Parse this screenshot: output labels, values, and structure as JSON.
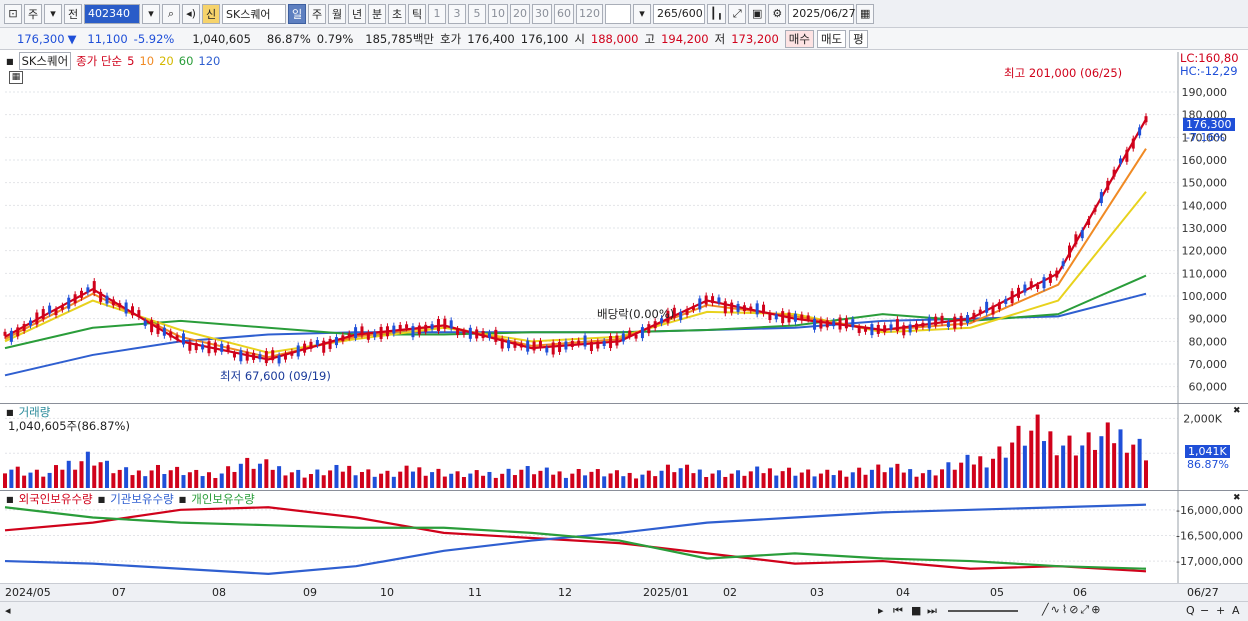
{
  "toolbar": {
    "period_main": "주",
    "prev_label": "전",
    "code": "402340",
    "badge": "신",
    "name": "SK스퀘어",
    "periods": [
      "일",
      "주",
      "월",
      "년",
      "분",
      "초",
      "틱"
    ],
    "selected_period": "일",
    "minutes": [
      "1",
      "3",
      "5",
      "10",
      "20",
      "30",
      "60",
      "120"
    ],
    "count": "265",
    "count_max": "/600",
    "date": "2025/06/27"
  },
  "quote": {
    "price": "176,300",
    "arrow": "▼",
    "change": "11,100",
    "change_pct": "-5.92%",
    "volume": "1,040,605",
    "vol_ratio": "86.87%",
    "turnover_ratio": "0.79%",
    "amount": "185,785백만",
    "hoga_label": "호가",
    "ask": "176,400",
    "bid": "176,100",
    "open_label": "시",
    "open": "188,000",
    "high_label": "고",
    "high": "194,200",
    "low_label": "저",
    "low": "173,200",
    "buy_label": "매수",
    "sell_label": "매도",
    "avg_label": "평"
  },
  "price_legend": {
    "name": "SK스퀘어",
    "series_label": "종가 단순",
    "ma": [
      {
        "label": "5",
        "color": "#d0021b"
      },
      {
        "label": "10",
        "color": "#f08a24"
      },
      {
        "label": "20",
        "color": "#e8d21d"
      },
      {
        "label": "60",
        "color": "#2a9d3a"
      },
      {
        "label": "120",
        "color": "#2f5fd0"
      }
    ]
  },
  "price_panel": {
    "lc": "LC:160,80",
    "hc": "HC:-12,29",
    "current_price": "176,300",
    "current_pct": "-7.16%",
    "high_annotation": "최고 201,000 (06/25)",
    "low_annotation": "최저 67,600 (09/19)",
    "dividend_annotation": "배당락(0.00%)"
  },
  "volume_legend": {
    "title": "거래량",
    "value": "1,040,605주(86.87%)",
    "current_label": "1,041K",
    "current_pct": "86.87%"
  },
  "holding_legend": {
    "items": [
      {
        "label": "외국인보유수량",
        "color": "#d0021b"
      },
      {
        "label": "기관보유수량",
        "color": "#2f5fd0"
      },
      {
        "label": "개인보유수량",
        "color": "#2a9d3a"
      }
    ]
  },
  "x_axis": {
    "labels": [
      "2024/05",
      "07",
      "08",
      "09",
      "10",
      "11",
      "12",
      "2025/01",
      "02",
      "03",
      "04",
      "05",
      "06"
    ],
    "end_label": "06/27"
  },
  "chart_data": [
    {
      "type": "line",
      "title": "SK스퀘어 일봉",
      "y_ticks": [
        60000,
        70000,
        80000,
        90000,
        100000,
        110000,
        120000,
        130000,
        140000,
        150000,
        160000,
        170000,
        180000,
        190000
      ],
      "ylim": [
        55000,
        205000
      ],
      "x": [
        "2024/05",
        "07",
        "08",
        "09",
        "10",
        "11",
        "12",
        "2025/01",
        "02",
        "03",
        "04",
        "05",
        "06",
        "06/27"
      ],
      "series": [
        {
          "name": "5",
          "values": [
            82000,
            103000,
            80000,
            72000,
            83000,
            87000,
            77000,
            80000,
            98000,
            90000,
            85000,
            90000,
            110000,
            178000
          ]
        },
        {
          "name": "10",
          "values": [
            81000,
            101000,
            82000,
            73000,
            82000,
            87000,
            78000,
            81000,
            96000,
            91000,
            85000,
            88000,
            105000,
            165000
          ]
        },
        {
          "name": "20",
          "values": [
            80000,
            98000,
            85000,
            75000,
            81000,
            86000,
            80000,
            82000,
            93000,
            92000,
            84000,
            86000,
            98000,
            146000
          ]
        },
        {
          "name": "60",
          "values": [
            77000,
            86000,
            89000,
            86000,
            83000,
            83000,
            84000,
            84000,
            85000,
            87000,
            92000,
            89000,
            92000,
            109000
          ]
        },
        {
          "name": "120",
          "values": [
            65000,
            74000,
            80000,
            83000,
            84000,
            84000,
            84000,
            84000,
            85000,
            86000,
            89000,
            90000,
            91000,
            101000
          ]
        }
      ],
      "annotations": [
        "최고 201,000 (06/25)",
        "최저 67,600 (09/19)",
        "배당락(0.00%)"
      ]
    },
    {
      "type": "bar",
      "title": "거래량",
      "y_ticks": [
        1000000,
        2000000
      ],
      "y_tick_labels": [
        "1,000K",
        "2,000K"
      ],
      "ylim": [
        0,
        2300000
      ],
      "values_k": [
        600,
        450,
        380,
        700,
        900,
        520,
        410,
        560,
        480,
        380,
        420,
        700,
        640,
        520,
        380,
        460,
        560,
        430,
        380,
        540,
        470,
        380,
        390,
        420,
        520,
        450,
        410,
        480,
        390,
        380,
        420,
        560,
        480,
        430,
        400,
        470,
        520,
        440,
        380,
        460,
        500,
        560,
        480,
        430,
        620,
        760,
        900,
        1400,
        1600,
        1300,
        1200,
        1400,
        1500,
        1041
      ]
    },
    {
      "type": "line",
      "title": "보유수량",
      "y_ticks": [
        -16000000,
        -16500000,
        -17000000
      ],
      "y_tick_labels": [
        "-16,000,000",
        "-16,500,000",
        "-17,000,000"
      ],
      "ylim": [
        -17350000,
        -15750000
      ],
      "series": [
        {
          "name": "외국인보유수량",
          "values": [
            -16400000,
            -16250000,
            -16000000,
            -15950000,
            -16150000,
            -16450000,
            -16550000,
            -16650000,
            -16850000,
            -17050000,
            -17000000,
            -17150000,
            -17100000,
            -17200000
          ]
        },
        {
          "name": "기관보유수량",
          "values": [
            -17000000,
            -17050000,
            -17150000,
            -17250000,
            -17100000,
            -16800000,
            -16600000,
            -16450000,
            -16250000,
            -16150000,
            -16050000,
            -16000000,
            -15950000,
            -15900000
          ]
        },
        {
          "name": "개인보유수량",
          "values": [
            -15950000,
            -16150000,
            -16250000,
            -16300000,
            -16350000,
            -16350000,
            -16450000,
            -16600000,
            -16950000,
            -16850000,
            -16950000,
            -17000000,
            -17100000,
            -17150000
          ]
        }
      ]
    }
  ]
}
